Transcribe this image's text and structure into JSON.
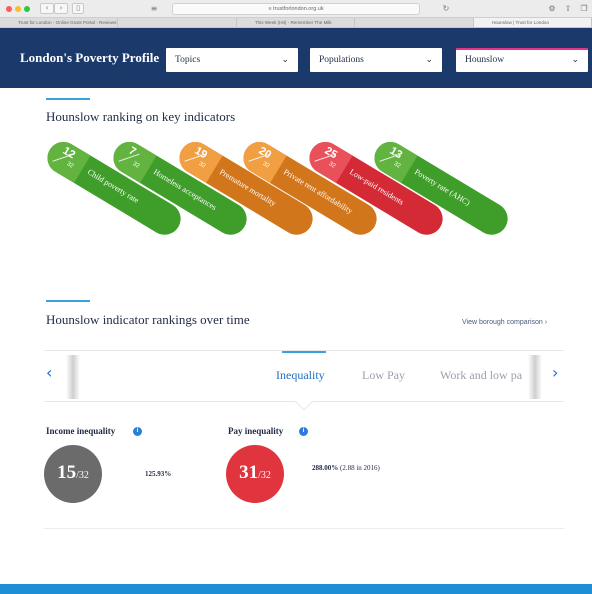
{
  "browser": {
    "url": "≡ trustforlondon.org.uk",
    "tabs": [
      "Trust for London - Online Grant Portal - Reviews - My Reviews - Home",
      "",
      "This Week (Hit) - Remember The Milk",
      "",
      "Hounslow | Trust for London"
    ]
  },
  "header": {
    "brand": "London's Poverty Profile",
    "topics_label": "Topics",
    "populations_label": "Populations",
    "borough_label": "Hounslow",
    "accent_color": "#e0348f"
  },
  "key_indicators": {
    "title": "Hounslow ranking on key indicators",
    "items": [
      {
        "rank": "12",
        "total": "32",
        "label": "Child poverty rate",
        "color": "#3f9e2a",
        "badge_color": "#62b33f"
      },
      {
        "rank": "7",
        "total": "32",
        "label": "Homeless acceptances",
        "color": "#3f9e2a",
        "badge_color": "#62b33f"
      },
      {
        "rank": "19",
        "total": "32",
        "label": "Premature mortality",
        "color": "#d2761c",
        "badge_color": "#f0a042"
      },
      {
        "rank": "20",
        "total": "32",
        "label": "Private rent affordability",
        "color": "#d2761c",
        "badge_color": "#f0a042"
      },
      {
        "rank": "25",
        "total": "32",
        "label": "Low-paid residents",
        "color": "#d42a35",
        "badge_color": "#e8505a"
      },
      {
        "rank": "13",
        "total": "32",
        "label": "Poverty rate (AHC)",
        "color": "#3f9e2a",
        "badge_color": "#62b33f"
      }
    ]
  },
  "over_time": {
    "title": "Hounslow indicator rankings over time",
    "view_link": "View borough comparison  ›",
    "tabs": [
      "Inequality",
      "Low Pay",
      "Work and low pa"
    ],
    "active_tab": "Inequality",
    "prev_icon": "chevron-left-icon",
    "next_icon": "chevron-right-icon"
  },
  "indicators": [
    {
      "title": "Income inequality",
      "rank": "15",
      "total": "/32",
      "value": "125.93%",
      "note": "",
      "color": "#6b6b6b"
    },
    {
      "title": "Pay inequality",
      "rank": "31",
      "total": "/32",
      "value": "288.00%",
      "note": "(2.88 in 2016)",
      "color": "#e0343e"
    }
  ],
  "colors": {
    "navy": "#1b3a6b",
    "link_blue": "#1f6fc4",
    "accent_blue": "#3aa0de",
    "footer_blue": "#1e8fd6"
  }
}
